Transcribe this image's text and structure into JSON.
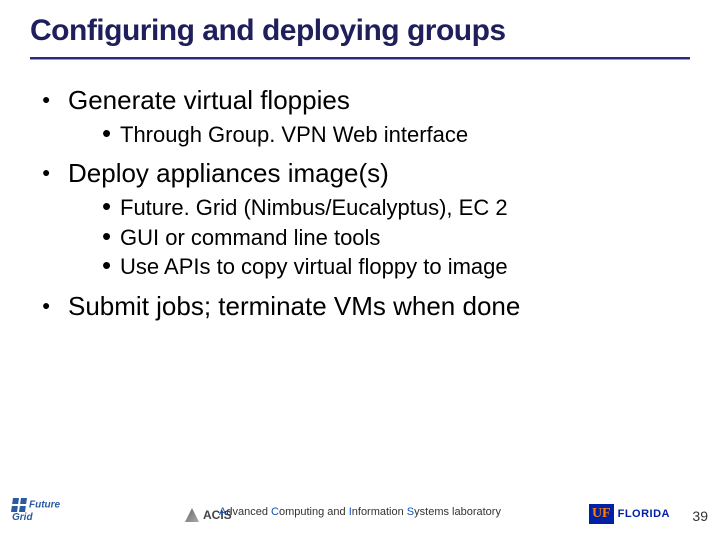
{
  "title": "Configuring and deploying groups",
  "bullets": [
    {
      "text": "Generate virtual floppies",
      "sub": [
        "Through Group. VPN Web interface"
      ]
    },
    {
      "text": "Deploy appliances image(s)",
      "sub": [
        "Future. Grid (Nimbus/Eucalyptus), EC 2",
        "GUI or command line tools",
        "Use APIs to copy virtual floppy to image"
      ]
    },
    {
      "text": "Submit jobs; terminate VMs when done",
      "sub": []
    }
  ],
  "footer": {
    "lab_text_parts": {
      "A": "A",
      "dvanced": "dvanced ",
      "C": "C",
      "omputing_and": "omputing and ",
      "I": "I",
      "nformation": "nformation ",
      "S": "S",
      "ystems_lab": "ystems laboratory"
    },
    "page_number": "39",
    "futuregrid": {
      "line1": "Future",
      "line2": "Grid"
    },
    "acis": "ACIS",
    "uf": {
      "monogram": "UF",
      "word": "FLORIDA"
    }
  }
}
